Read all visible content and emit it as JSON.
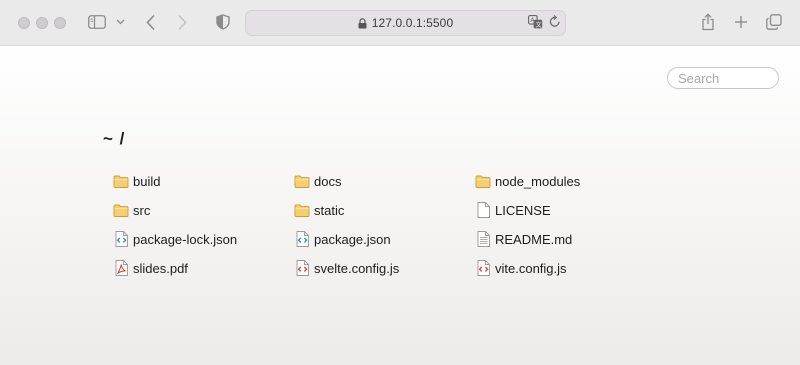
{
  "browser": {
    "url": "127.0.0.1:5500",
    "accent": "#d7a52b"
  },
  "page": {
    "search_placeholder": "Search",
    "breadcrumb": "~ /"
  },
  "files": [
    {
      "name": "build",
      "icon": "folder-icon"
    },
    {
      "name": "docs",
      "icon": "folder-icon"
    },
    {
      "name": "node_modules",
      "icon": "folder-icon"
    },
    {
      "name": "src",
      "icon": "folder-icon"
    },
    {
      "name": "static",
      "icon": "folder-icon"
    },
    {
      "name": "LICENSE",
      "icon": "blank-file-icon"
    },
    {
      "name": "package-lock.json",
      "icon": "json-file-icon"
    },
    {
      "name": "package.json",
      "icon": "json-file-icon"
    },
    {
      "name": "README.md",
      "icon": "text-file-icon"
    },
    {
      "name": "slides.pdf",
      "icon": "pdf-file-icon"
    },
    {
      "name": "svelte.config.js",
      "icon": "js-file-icon"
    },
    {
      "name": "vite.config.js",
      "icon": "js-file-icon"
    }
  ]
}
